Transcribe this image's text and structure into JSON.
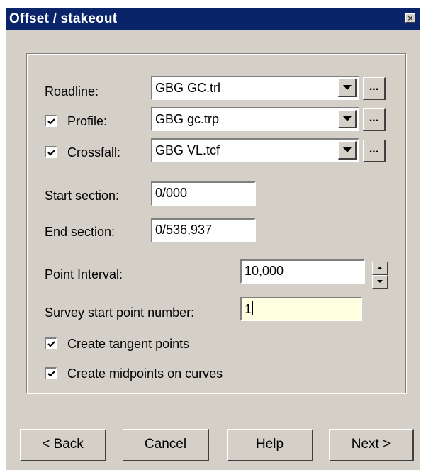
{
  "window": {
    "title": "Offset / stakeout",
    "close_symbol": "×"
  },
  "fields": {
    "roadline": {
      "label": "Roadline:",
      "value": "GBG GC.trl",
      "browse": "..."
    },
    "profile": {
      "label": "Profile:",
      "value": "GBG gc.trp",
      "browse": "...",
      "checked": true
    },
    "crossfall": {
      "label": "Crossfall:",
      "value": "GBG VL.tcf",
      "browse": "...",
      "checked": true
    },
    "start_section": {
      "label": "Start section:",
      "value": "0/000"
    },
    "end_section": {
      "label": "End section:",
      "value": "0/536,937"
    },
    "point_interval": {
      "label": "Point Interval:",
      "value": "10,000"
    },
    "survey_start": {
      "label": "Survey start point number:",
      "value": "1"
    }
  },
  "options": {
    "tangent_points": {
      "label": "Create tangent points",
      "checked": true
    },
    "midpoints": {
      "label": "Create midpoints on curves",
      "checked": true
    }
  },
  "buttons": {
    "back": "< Back",
    "cancel": "Cancel",
    "help": "Help",
    "next": "Next >"
  }
}
